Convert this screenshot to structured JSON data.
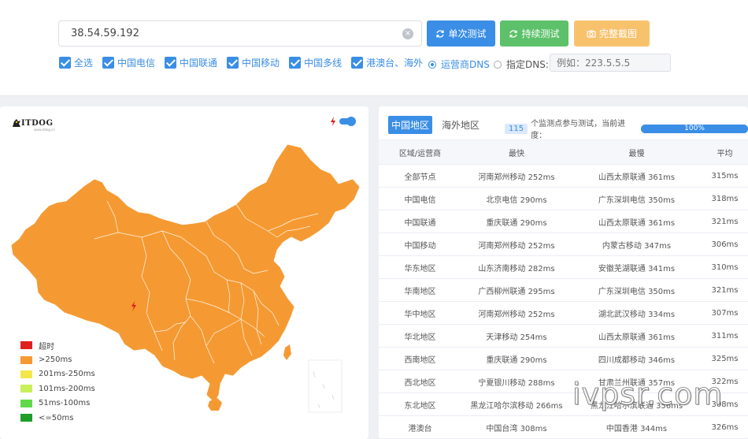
{
  "search": {
    "ip_value": "38.54.59.192",
    "clear_icon": "clear-icon"
  },
  "buttons": {
    "single_test": "单次测试",
    "continuous_test": "持续测试",
    "full_screenshot": "完整截图",
    "colors": {
      "single": "#3a8ee6",
      "continuous": "#5cc16a",
      "screenshot": "#f8c26d"
    }
  },
  "filters": [
    {
      "label": "全选",
      "checked": true
    },
    {
      "label": "中国电信",
      "checked": true
    },
    {
      "label": "中国联通",
      "checked": true
    },
    {
      "label": "中国移动",
      "checked": true
    },
    {
      "label": "中国多线",
      "checked": true
    },
    {
      "label": "港澳台、海外",
      "checked": true
    }
  ],
  "dns": {
    "operator_label": "运营商DNS",
    "custom_label": "指定DNS:",
    "custom_placeholder": "例如：223.5.5.5",
    "selected": "operator"
  },
  "map": {
    "logo_text": "ITDOG",
    "logo_sub": "www.itdog.cn",
    "fill_color": "#f59a33",
    "legend": [
      {
        "label": "超时",
        "color": "#e0201e"
      },
      {
        "label": ">250ms",
        "color": "#f59a33"
      },
      {
        "label": "201ms-250ms",
        "color": "#f2e64a"
      },
      {
        "label": "101ms-200ms",
        "color": "#c7f05a"
      },
      {
        "label": "51ms-100ms",
        "color": "#5fd94a"
      },
      {
        "label": "<=50ms",
        "color": "#1f9e2a"
      }
    ]
  },
  "results": {
    "tabs": [
      {
        "label": "中国地区",
        "active": true
      },
      {
        "label": "海外地区",
        "active": false
      }
    ],
    "node_count": "115",
    "progress_caption": "个监测点参与测试，当前进度：",
    "progress_value": 1.0,
    "progress_text": "100%",
    "headers": {
      "region": "区域/运营商",
      "fastest": "最快",
      "slowest": "最慢",
      "average": "平均"
    },
    "rows": [
      {
        "region": "全部节点",
        "fastest": "河南郑州移动 252ms",
        "slowest": "山西太原联通 361ms",
        "average": "315ms"
      },
      {
        "region": "中国电信",
        "fastest": "北京电信 290ms",
        "slowest": "广东深圳电信 350ms",
        "average": "318ms"
      },
      {
        "region": "中国联通",
        "fastest": "重庆联通 290ms",
        "slowest": "山西太原联通 361ms",
        "average": "321ms"
      },
      {
        "region": "中国移动",
        "fastest": "河南郑州移动 252ms",
        "slowest": "内蒙古移动 347ms",
        "average": "306ms"
      },
      {
        "region": "华东地区",
        "fastest": "山东济南移动 282ms",
        "slowest": "安徽芜湖联通 341ms",
        "average": "310ms"
      },
      {
        "region": "华南地区",
        "fastest": "广西柳州联通 295ms",
        "slowest": "广东深圳电信 350ms",
        "average": "321ms"
      },
      {
        "region": "华中地区",
        "fastest": "河南郑州移动 252ms",
        "slowest": "湖北武汉移动 334ms",
        "average": "307ms"
      },
      {
        "region": "华北地区",
        "fastest": "天津移动 254ms",
        "slowest": "山西太原联通 361ms",
        "average": "311ms"
      },
      {
        "region": "西南地区",
        "fastest": "重庆联通 290ms",
        "slowest": "四川成都移动 346ms",
        "average": "325ms"
      },
      {
        "region": "西北地区",
        "fastest": "宁夏银川移动 288ms",
        "slowest": "甘肃兰州联通 357ms",
        "average": "322ms"
      },
      {
        "region": "东北地区",
        "fastest": "黑龙江哈尔滨移动 266ms",
        "slowest": "黑龙江哈尔滨联通 356ms",
        "average": "308ms"
      },
      {
        "region": "港澳台",
        "fastest": "中国台湾 308ms",
        "slowest": "中国香港 344ms",
        "average": "326ms"
      }
    ]
  },
  "watermark": "ivpsr.com"
}
